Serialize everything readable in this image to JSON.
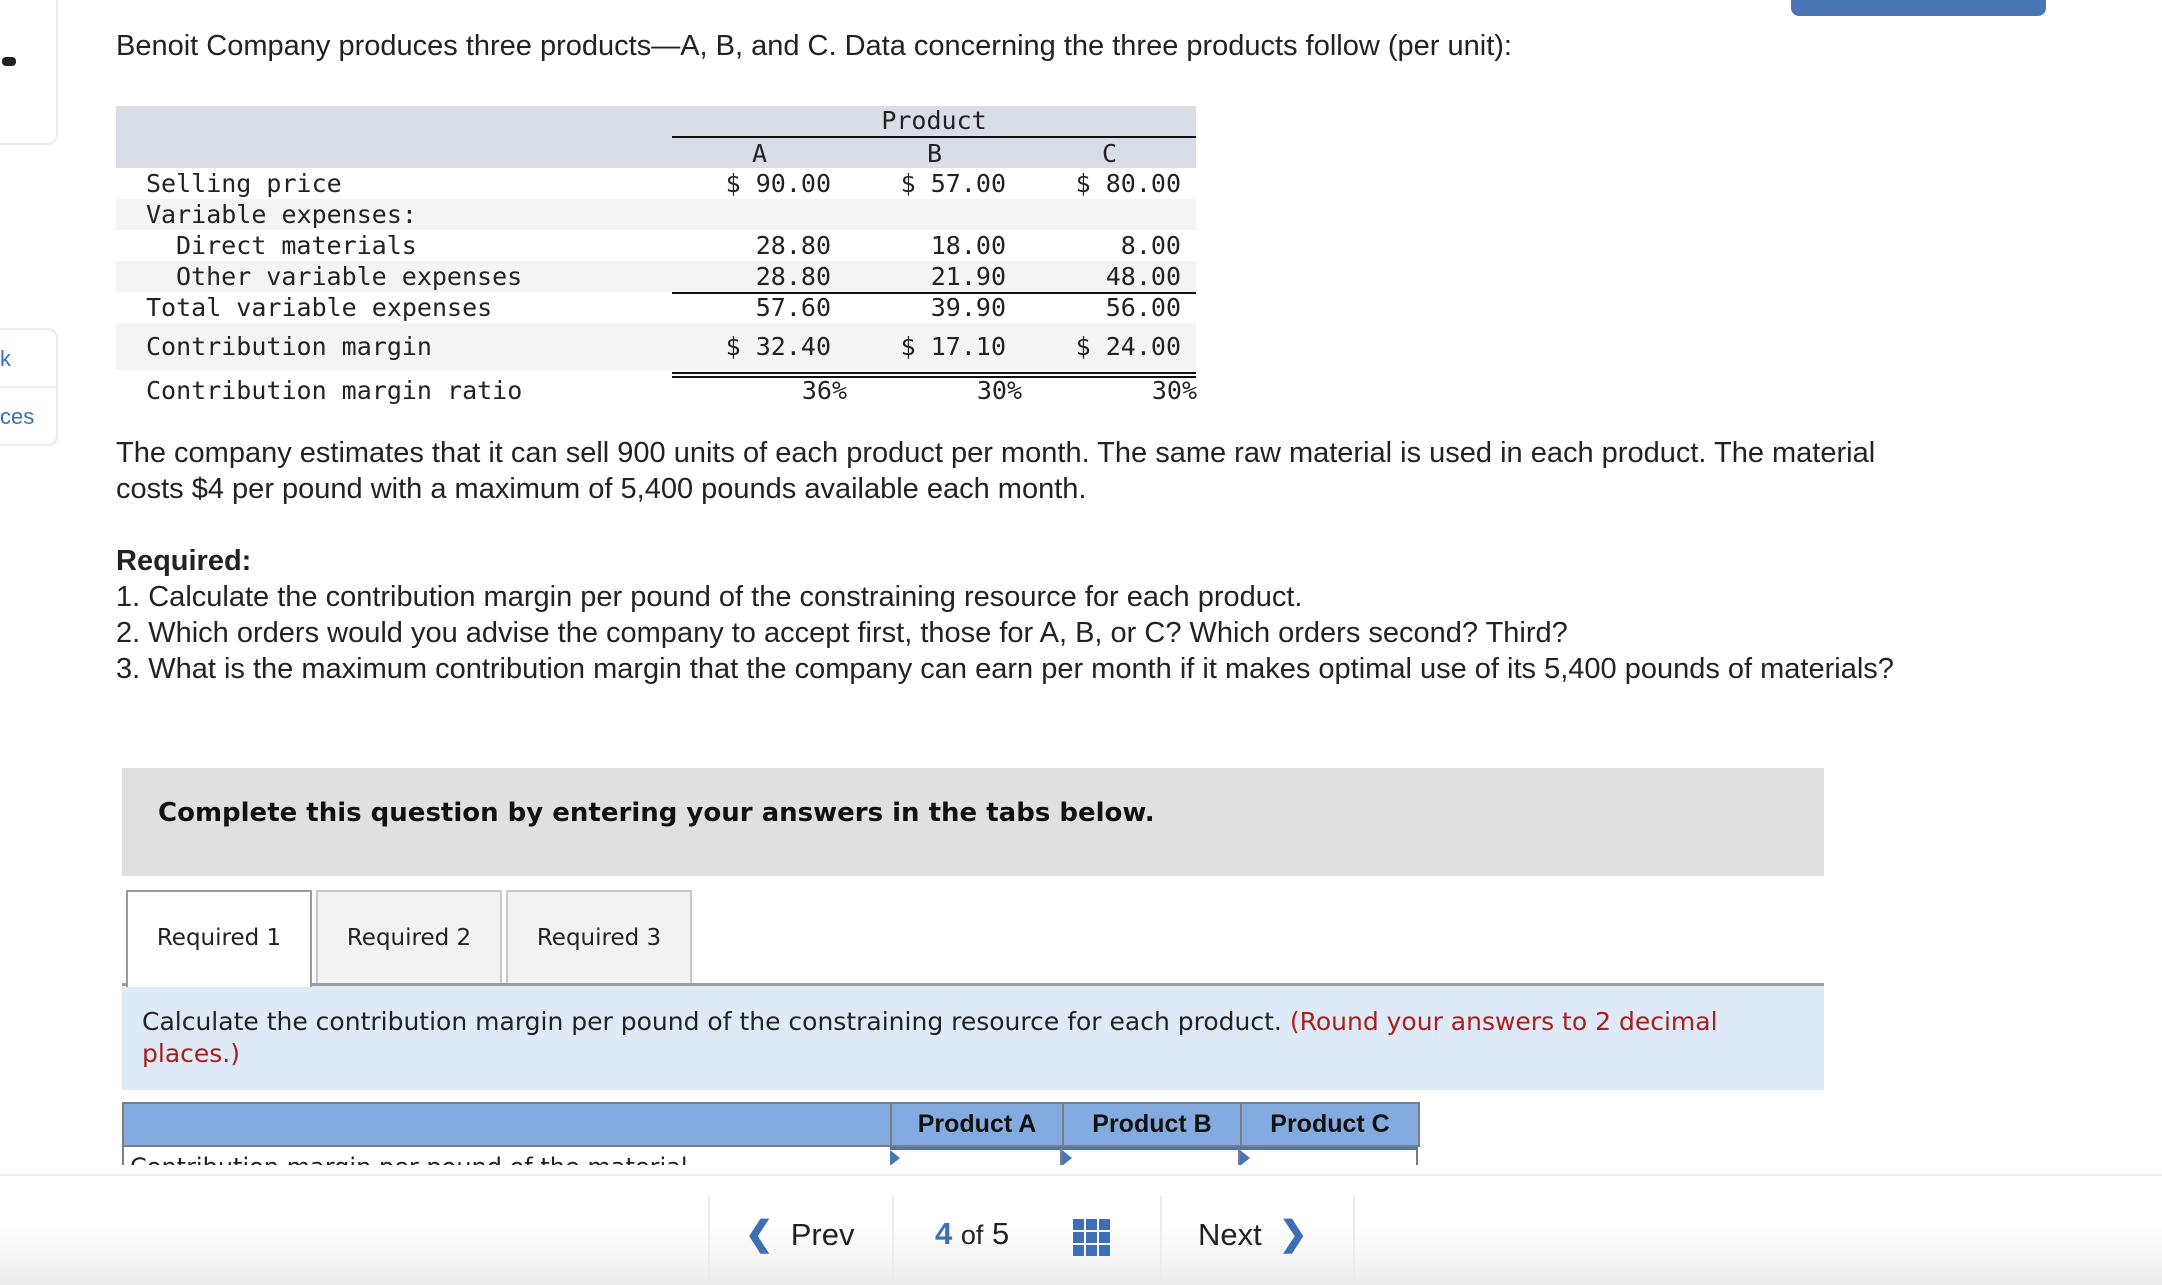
{
  "sidebar": {
    "links": [
      "k",
      "ces"
    ]
  },
  "problem": {
    "title": "Benoit Company produces three products—A, B, and C. Data concerning the three products follow (per unit):",
    "table": {
      "group_header": "Product",
      "columns": [
        "A",
        "B",
        "C"
      ],
      "rows": [
        {
          "label": "Selling price",
          "values": [
            "$ 90.00",
            "$ 57.00",
            "$ 80.00"
          ]
        },
        {
          "label": "Variable expenses:",
          "values": [
            "",
            "",
            ""
          ]
        },
        {
          "label": "Direct materials",
          "values": [
            "28.80",
            "18.00",
            "8.00"
          ]
        },
        {
          "label": "Other variable expenses",
          "values": [
            "28.80",
            "21.90",
            "48.00"
          ]
        },
        {
          "label": "Total variable expenses",
          "values": [
            "57.60",
            "39.90",
            "56.00"
          ]
        },
        {
          "label": "Contribution margin",
          "values": [
            "$ 32.40",
            "$ 17.10",
            "$ 24.00"
          ]
        },
        {
          "label": "Contribution margin ratio",
          "values": [
            "36%",
            "30%",
            "30%"
          ]
        }
      ]
    },
    "paragraph": "The company estimates that it can sell 900 units of each product per month. The same raw material is used in each product. The material costs $4 per pound with a maximum of 5,400 pounds available each month.",
    "required_heading": "Required:",
    "required_items": [
      "1. Calculate the contribution margin per pound of the constraining resource for each product.",
      "2. Which orders would you advise the company to accept first, those for A, B, or C? Which orders second? Third?",
      "3. What is the maximum contribution margin that the company can earn per month if it makes optimal use of its 5,400 pounds of materials?"
    ]
  },
  "instructions_box": "Complete this question by entering your answers in the tabs below.",
  "tabs": [
    {
      "label": "Required 1",
      "active": true
    },
    {
      "label": "Required 2",
      "active": false
    },
    {
      "label": "Required 3",
      "active": false
    }
  ],
  "tab_content": {
    "instruction": "Calculate the contribution margin per pound of the constraining resource for each product.",
    "note": "(Round your answers to 2 decimal places.)"
  },
  "answer_table": {
    "headers": [
      "",
      "Product A",
      "Product B",
      "Product C"
    ],
    "row_label": "Contribution margin per pound of the material",
    "values": [
      "",
      "",
      ""
    ]
  },
  "colors": {
    "accent": "#3c6fb8",
    "answer_header_bg": "#84abe0",
    "note_red": "#a8201a",
    "instruction_bg": "#deeaf7"
  },
  "nav": {
    "prev_label": "Prev",
    "current_page": "4",
    "of_label": "of",
    "total_pages": "5",
    "next_label": "Next"
  }
}
